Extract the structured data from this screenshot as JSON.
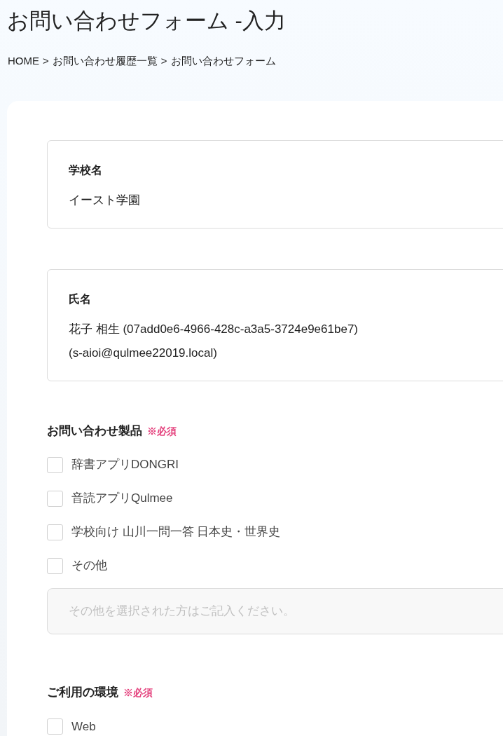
{
  "page_title": "お問い合わせフォーム -入力",
  "breadcrumb": {
    "separator": ">",
    "items": [
      "HOME",
      "お問い合わせ履歴一覧",
      "お問い合わせフォーム"
    ]
  },
  "info_boxes": [
    {
      "label": "学校名",
      "lines": [
        "イースト学園"
      ]
    },
    {
      "label": "氏名",
      "lines": [
        "花子 相生 (07add0e6-4966-428c-a3a5-3724e9e61be7)",
        "(s-aioi@qulmee22019.local)"
      ]
    }
  ],
  "sections": [
    {
      "label": "お問い合わせ製品",
      "required": "※必須",
      "options": [
        {
          "label": "辞書アプリDONGRI",
          "checked": false
        },
        {
          "label": "音読アプリQulmee",
          "checked": false
        },
        {
          "label": "学校向け 山川一問一答 日本史・世界史",
          "checked": false
        },
        {
          "label": "その他",
          "checked": false
        }
      ],
      "other_field": {
        "placeholder": "その他を選択された方はご記入ください。"
      }
    },
    {
      "label": "ご利用の環境",
      "required": "※必須",
      "options": [
        {
          "label": "Web",
          "checked": false
        }
      ]
    }
  ]
}
